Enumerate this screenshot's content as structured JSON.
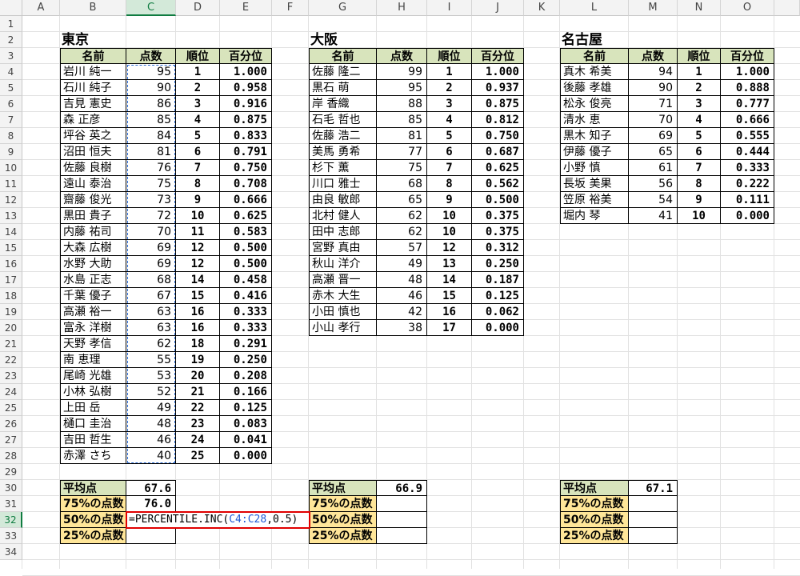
{
  "columns": [
    "A",
    "B",
    "C",
    "D",
    "E",
    "F",
    "G",
    "H",
    "I",
    "J",
    "K",
    "L",
    "M",
    "N",
    "O"
  ],
  "rows": [
    "1",
    "2",
    "3",
    "4",
    "5",
    "6",
    "7",
    "8",
    "9",
    "10",
    "11",
    "12",
    "13",
    "14",
    "15",
    "16",
    "17",
    "18",
    "19",
    "20",
    "21",
    "22",
    "23",
    "24",
    "25",
    "26",
    "27",
    "28",
    "29",
    "30",
    "31",
    "32",
    "33",
    "34"
  ],
  "selected_column": "C",
  "selected_row": "32",
  "headers": {
    "name": "名前",
    "score": "点数",
    "rank": "順位",
    "pct": "百分位"
  },
  "summary_labels": {
    "avg": "平均点",
    "p75": "75%の点数",
    "p50": "50%の点数",
    "p25": "25%の点数"
  },
  "formula": {
    "prefix": "=PERCENTILE.INC(",
    "range": "C4:C28",
    "suffix": ",0.5)"
  },
  "tables": [
    {
      "title": "東京",
      "rows": [
        [
          "岩川 純一",
          "95",
          "1",
          "1.000"
        ],
        [
          "石川 純子",
          "90",
          "2",
          "0.958"
        ],
        [
          "吉見 憲史",
          "86",
          "3",
          "0.916"
        ],
        [
          "森 正彦",
          "85",
          "4",
          "0.875"
        ],
        [
          "坪谷 英之",
          "84",
          "5",
          "0.833"
        ],
        [
          "沼田 恒夫",
          "81",
          "6",
          "0.791"
        ],
        [
          "佐藤 良樹",
          "76",
          "7",
          "0.750"
        ],
        [
          "遠山 泰治",
          "75",
          "8",
          "0.708"
        ],
        [
          "齋藤 俊光",
          "73",
          "9",
          "0.666"
        ],
        [
          "黒田 貴子",
          "72",
          "10",
          "0.625"
        ],
        [
          "内藤 祐司",
          "70",
          "11",
          "0.583"
        ],
        [
          "大森 広樹",
          "69",
          "12",
          "0.500"
        ],
        [
          "水野 大助",
          "69",
          "12",
          "0.500"
        ],
        [
          "水島 正志",
          "68",
          "14",
          "0.458"
        ],
        [
          "千葉 優子",
          "67",
          "15",
          "0.416"
        ],
        [
          "高瀬 裕一",
          "63",
          "16",
          "0.333"
        ],
        [
          "富永 洋樹",
          "63",
          "16",
          "0.333"
        ],
        [
          "天野 孝信",
          "62",
          "18",
          "0.291"
        ],
        [
          "南 恵理",
          "55",
          "19",
          "0.250"
        ],
        [
          "尾崎 光雄",
          "53",
          "20",
          "0.208"
        ],
        [
          "小林 弘樹",
          "52",
          "21",
          "0.166"
        ],
        [
          "上田 岳",
          "49",
          "22",
          "0.125"
        ],
        [
          "樋口 圭治",
          "48",
          "23",
          "0.083"
        ],
        [
          "吉田 哲生",
          "46",
          "24",
          "0.041"
        ],
        [
          "赤澤 さち",
          "40",
          "25",
          "0.000"
        ]
      ],
      "avg": "67.6",
      "p75": "76.0"
    },
    {
      "title": "大阪",
      "rows": [
        [
          "佐藤 隆二",
          "99",
          "1",
          "1.000"
        ],
        [
          "黒石 萌",
          "95",
          "2",
          "0.937"
        ],
        [
          "岸 香織",
          "88",
          "3",
          "0.875"
        ],
        [
          "石毛 哲也",
          "85",
          "4",
          "0.812"
        ],
        [
          "佐藤 浩二",
          "81",
          "5",
          "0.750"
        ],
        [
          "美馬 勇希",
          "77",
          "6",
          "0.687"
        ],
        [
          "杉下 薫",
          "75",
          "7",
          "0.625"
        ],
        [
          "川口 雅士",
          "68",
          "8",
          "0.562"
        ],
        [
          "由良 敏郎",
          "65",
          "9",
          "0.500"
        ],
        [
          "北村 健人",
          "62",
          "10",
          "0.375"
        ],
        [
          "田中 志郎",
          "62",
          "10",
          "0.375"
        ],
        [
          "宮野 真由",
          "57",
          "12",
          "0.312"
        ],
        [
          "秋山 洋介",
          "49",
          "13",
          "0.250"
        ],
        [
          "高瀬 晋一",
          "48",
          "14",
          "0.187"
        ],
        [
          "赤木 大生",
          "46",
          "15",
          "0.125"
        ],
        [
          "小田 慎也",
          "42",
          "16",
          "0.062"
        ],
        [
          "小山 孝行",
          "38",
          "17",
          "0.000"
        ]
      ],
      "avg": "66.9",
      "p75": ""
    },
    {
      "title": "名古屋",
      "rows": [
        [
          "真木 希美",
          "94",
          "1",
          "1.000"
        ],
        [
          "後藤 孝雄",
          "90",
          "2",
          "0.888"
        ],
        [
          "松永 俊亮",
          "71",
          "3",
          "0.777"
        ],
        [
          "清水 恵",
          "70",
          "4",
          "0.666"
        ],
        [
          "黒木 知子",
          "69",
          "5",
          "0.555"
        ],
        [
          "伊藤 優子",
          "65",
          "6",
          "0.444"
        ],
        [
          "小野 慎",
          "61",
          "7",
          "0.333"
        ],
        [
          "長坂 美果",
          "56",
          "8",
          "0.222"
        ],
        [
          "笠原 裕美",
          "54",
          "9",
          "0.111"
        ],
        [
          "堀内 琴",
          "41",
          "10",
          "0.000"
        ]
      ],
      "avg": "67.1",
      "p75": ""
    }
  ]
}
